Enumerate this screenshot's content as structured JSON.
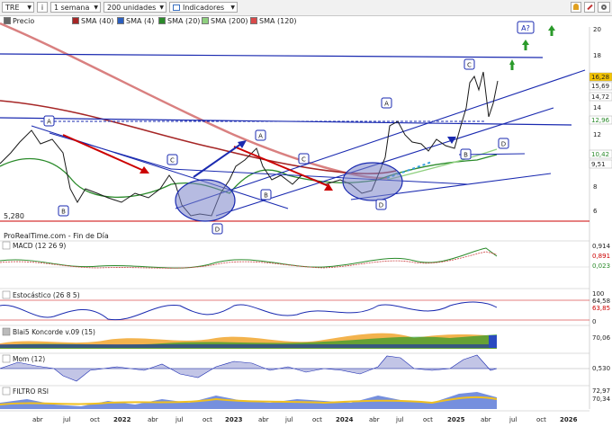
{
  "toolbar": {
    "ticker": "TRE",
    "info_icon": "i",
    "period": "1 semana",
    "units": "200 unidades",
    "indicators_label": "Indicadores"
  },
  "legend": [
    {
      "label": "Precio",
      "color": "#666666"
    },
    {
      "label": "SMA (40)",
      "color": "#a62626"
    },
    {
      "label": "SMA (4)",
      "color": "#2b5fbf"
    },
    {
      "label": "SMA (20)",
      "color": "#2a8a2a"
    },
    {
      "label": "SMA (200)",
      "color": "#8fd07f"
    },
    {
      "label": "SMA (120)",
      "color": "#d94a4a"
    }
  ],
  "price_axis": [
    "20",
    "18",
    "16",
    "14",
    "12",
    "10",
    "8",
    "6"
  ],
  "value_tags": [
    {
      "text": "16,28",
      "bg": "#f5c400"
    },
    {
      "text": "15,69",
      "bg": "#ffffff"
    },
    {
      "text": "14,72",
      "bg": "#ffffff"
    },
    {
      "text": "12,96",
      "bg": "#ffffff"
    },
    {
      "text": "10,42",
      "bg": "#ffffff"
    },
    {
      "text": "9,51",
      "bg": "#ffffff"
    }
  ],
  "price_min_label": "5,280",
  "source_label": "ProRealTime.com - Fin de Día",
  "wave_labels": [
    "A",
    "B",
    "C",
    "D",
    "A",
    "B",
    "C",
    "D",
    "A",
    "B",
    "C",
    "D",
    "A?"
  ],
  "panels": [
    {
      "title": "MACD (12 26 9)",
      "axis": [
        "0,914",
        "0,891",
        "0,023"
      ]
    },
    {
      "title": "Estocástico (26 8 5)",
      "axis": [
        "100",
        "64,58",
        "63,85",
        "0"
      ]
    },
    {
      "title": "Blai5 Koncorde v.09 (15)",
      "axis": [
        "70,06"
      ]
    },
    {
      "title": "Mom (12)",
      "axis": [
        "0,530"
      ]
    },
    {
      "title": "FILTRO RSI",
      "axis": [
        "72,97",
        "70,34"
      ]
    }
  ],
  "x_axis": [
    "abr",
    "jul",
    "oct",
    "2022",
    "abr",
    "jul",
    "oct",
    "2023",
    "abr",
    "jul",
    "oct",
    "2024",
    "abr",
    "jul",
    "oct",
    "2025",
    "abr",
    "jul",
    "oct",
    "2026"
  ],
  "colors": {
    "accent_red": "#cc0000",
    "trend_blue": "#1a2ab0",
    "up_arrow": "#2a9a2a"
  }
}
